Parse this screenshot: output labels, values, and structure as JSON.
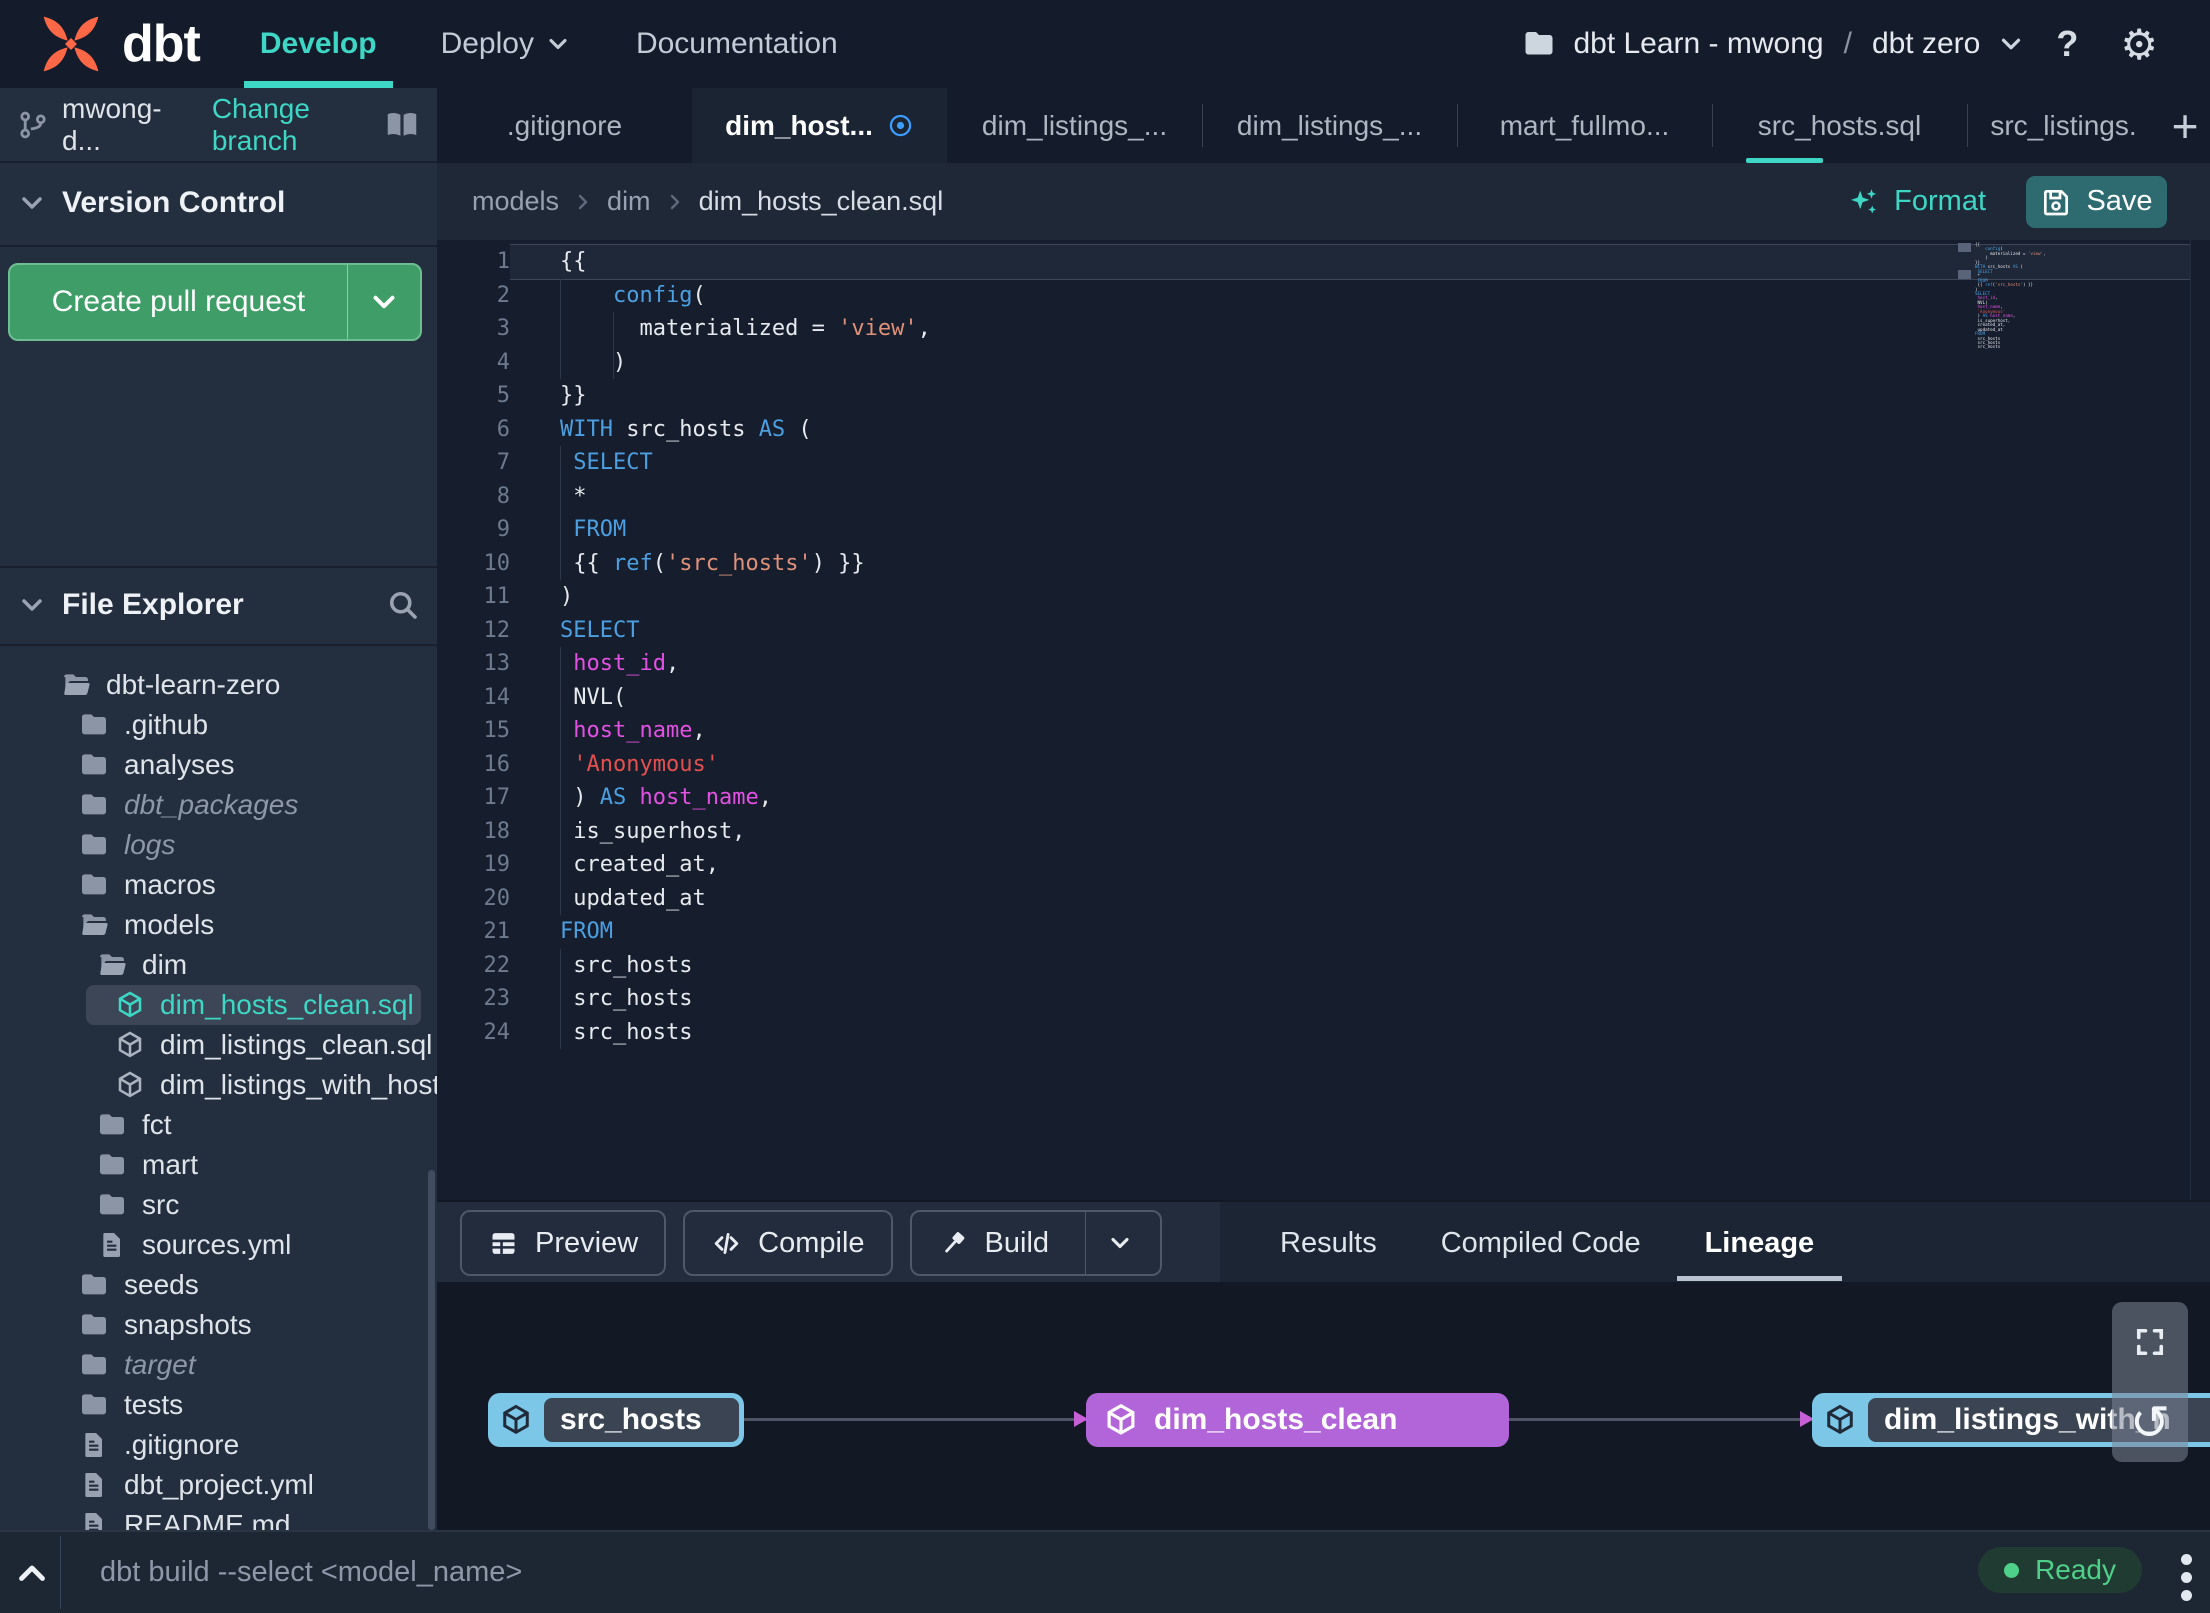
{
  "colors": {
    "accent_teal": "#3ed6c4",
    "pr_green": "#3f9d68",
    "save_teal": "#2d6b71",
    "node_blue": "#7cc7e8",
    "node_purple": "#b264d9",
    "status_green": "#4fd08a",
    "modified_blue": "#3b9eff",
    "logo_orange": "#ff6847"
  },
  "icons": {
    "help_glyph": "?",
    "settings_glyph": "⚙",
    "add_tab_glyph": "+",
    "reset_glyph": "↺"
  },
  "nav": {
    "brand": "dbt",
    "menu": [
      {
        "label": "Develop",
        "active": true,
        "chevron": false
      },
      {
        "label": "Deploy",
        "active": false,
        "chevron": true
      },
      {
        "label": "Documentation",
        "active": false,
        "chevron": false
      }
    ],
    "project": {
      "name": "dbt Learn - mwong",
      "separator": "/",
      "env": "dbt zero"
    }
  },
  "sidebar": {
    "branch": {
      "name": "mwong-d...",
      "change_action": "Change branch"
    },
    "version_control": {
      "title": "Version Control",
      "create_pr_label": "Create pull request"
    },
    "file_explorer": {
      "title": "File Explorer"
    },
    "tree": [
      {
        "label": "dbt-learn-zero",
        "icon": "folder-open-icon",
        "level": 0
      },
      {
        "label": ".github",
        "icon": "folder-icon",
        "level": 1
      },
      {
        "label": "analyses",
        "icon": "folder-icon",
        "level": 1
      },
      {
        "label": "dbt_packages",
        "icon": "folder-icon",
        "level": 1,
        "dim": true
      },
      {
        "label": "logs",
        "icon": "folder-icon",
        "level": 1,
        "dim": true
      },
      {
        "label": "macros",
        "icon": "folder-icon",
        "level": 1
      },
      {
        "label": "models",
        "icon": "folder-open-icon",
        "level": 1
      },
      {
        "label": "dim",
        "icon": "folder-open-icon",
        "level": 2
      },
      {
        "label": "dim_hosts_clean.sql",
        "icon": "model-cube-icon",
        "level": 3,
        "selected": true,
        "modified": true
      },
      {
        "label": "dim_listings_clean.sql",
        "icon": "model-cube-icon",
        "level": 3
      },
      {
        "label": "dim_listings_with_hosts...",
        "icon": "model-cube-icon",
        "level": 3
      },
      {
        "label": "fct",
        "icon": "folder-icon",
        "level": 2
      },
      {
        "label": "mart",
        "icon": "folder-icon",
        "level": 2
      },
      {
        "label": "src",
        "icon": "folder-icon",
        "level": 2
      },
      {
        "label": "sources.yml",
        "icon": "file-icon",
        "level": 2
      },
      {
        "label": "seeds",
        "icon": "folder-icon",
        "level": 1
      },
      {
        "label": "snapshots",
        "icon": "folder-icon",
        "level": 1
      },
      {
        "label": "target",
        "icon": "folder-icon",
        "level": 1,
        "dim": true
      },
      {
        "label": "tests",
        "icon": "folder-icon",
        "level": 1
      },
      {
        "label": ".gitignore",
        "icon": "file-icon",
        "level": 1
      },
      {
        "label": "dbt_project.yml",
        "icon": "file-icon",
        "level": 1
      },
      {
        "label": "README.md",
        "icon": "file-icon",
        "level": 1
      }
    ]
  },
  "workspace": {
    "tabs": [
      {
        "label": ".gitignore",
        "active": false,
        "modified": false
      },
      {
        "label": "dim_host...",
        "active": true,
        "modified": true
      },
      {
        "label": "dim_listings_...",
        "active": false,
        "modified": false
      },
      {
        "label": "dim_listings_...",
        "active": false,
        "modified": false
      },
      {
        "label": "mart_fullmo...",
        "active": false,
        "modified": false
      },
      {
        "label": "src_hosts.sql",
        "active": false,
        "modified": false
      },
      {
        "label": "src_listings.",
        "active": false,
        "modified": false
      }
    ],
    "breadcrumb": [
      "models",
      "dim",
      "dim_hosts_clean.sql"
    ],
    "format_label": "Format",
    "save_label": "Save"
  },
  "editor": {
    "lines": [
      {
        "n": 1,
        "cur": true,
        "seg": [
          [
            "{{",
            "def"
          ]
        ]
      },
      {
        "n": 2,
        "g": [
          0
        ],
        "seg": [
          [
            "    ",
            "def"
          ],
          [
            "config",
            "kw"
          ],
          [
            "(",
            "def"
          ]
        ]
      },
      {
        "n": 3,
        "g": [
          0,
          4
        ],
        "seg": [
          [
            "      materialized = ",
            "def"
          ],
          [
            "'view'",
            "jstr"
          ],
          [
            ",",
            "def"
          ]
        ]
      },
      {
        "n": 4,
        "g": [
          0,
          4
        ],
        "seg": [
          [
            "    )",
            "def"
          ]
        ]
      },
      {
        "n": 5,
        "seg": [
          [
            "}}",
            "def"
          ]
        ]
      },
      {
        "n": 6,
        "seg": [
          [
            "WITH",
            "kw"
          ],
          [
            " src_hosts ",
            "def"
          ],
          [
            "AS",
            "kw"
          ],
          [
            " (",
            "def"
          ]
        ]
      },
      {
        "n": 7,
        "g": [
          0
        ],
        "seg": [
          [
            " ",
            "def"
          ],
          [
            "SELECT",
            "kw"
          ]
        ]
      },
      {
        "n": 8,
        "g": [
          0
        ],
        "seg": [
          [
            " *",
            "def"
          ]
        ]
      },
      {
        "n": 9,
        "g": [
          0
        ],
        "seg": [
          [
            " ",
            "def"
          ],
          [
            "FROM",
            "kw"
          ]
        ]
      },
      {
        "n": 10,
        "g": [
          0
        ],
        "seg": [
          [
            " {{ ",
            "def"
          ],
          [
            "ref",
            "kw"
          ],
          [
            "(",
            "def"
          ],
          [
            "'src_hosts'",
            "jstr"
          ],
          [
            ") }}",
            "def"
          ]
        ]
      },
      {
        "n": 11,
        "seg": [
          [
            ")",
            "def"
          ]
        ]
      },
      {
        "n": 12,
        "seg": [
          [
            "SELECT",
            "kw"
          ]
        ]
      },
      {
        "n": 13,
        "g": [
          0
        ],
        "seg": [
          [
            " ",
            "def"
          ],
          [
            "host_id",
            "id"
          ],
          [
            ",",
            "def"
          ]
        ]
      },
      {
        "n": 14,
        "g": [
          0
        ],
        "seg": [
          [
            " NVL(",
            "def"
          ]
        ]
      },
      {
        "n": 15,
        "g": [
          0
        ],
        "seg": [
          [
            " ",
            "def"
          ],
          [
            "host_name",
            "id"
          ],
          [
            ",",
            "def"
          ]
        ]
      },
      {
        "n": 16,
        "g": [
          0
        ],
        "seg": [
          [
            " ",
            "def"
          ],
          [
            "'Anonymous'",
            "sqlstr"
          ]
        ]
      },
      {
        "n": 17,
        "g": [
          0
        ],
        "seg": [
          [
            " ) ",
            "def"
          ],
          [
            "AS",
            "kw"
          ],
          [
            " ",
            "def"
          ],
          [
            "host_name",
            "id"
          ],
          [
            ",",
            "def"
          ]
        ]
      },
      {
        "n": 18,
        "g": [
          0
        ],
        "seg": [
          [
            " is_superhost,",
            "def"
          ]
        ]
      },
      {
        "n": 19,
        "g": [
          0
        ],
        "seg": [
          [
            " created_at,",
            "def"
          ]
        ]
      },
      {
        "n": 20,
        "g": [
          0
        ],
        "seg": [
          [
            " updated_at",
            "def"
          ]
        ]
      },
      {
        "n": 21,
        "seg": [
          [
            "FROM",
            "kw"
          ]
        ]
      },
      {
        "n": 22,
        "g": [
          0
        ],
        "seg": [
          [
            " src_hosts",
            "def"
          ]
        ]
      },
      {
        "n": 23,
        "g": [
          0
        ],
        "seg": [
          [
            " src_hosts",
            "def"
          ]
        ]
      },
      {
        "n": 24,
        "g": [
          0
        ],
        "seg": [
          [
            " src_hosts",
            "def"
          ]
        ]
      }
    ]
  },
  "bottom_panel": {
    "buttons": [
      {
        "label": "Preview",
        "icon": "table-icon",
        "split": false
      },
      {
        "label": "Compile",
        "icon": "code-icon",
        "split": false
      },
      {
        "label": "Build",
        "icon": "hammer-icon",
        "split": true
      }
    ],
    "tabs": [
      {
        "label": "Results",
        "active": false
      },
      {
        "label": "Compiled Code",
        "active": false
      },
      {
        "label": "Lineage",
        "active": true
      }
    ]
  },
  "lineage": {
    "nodes": [
      {
        "label": "src_hosts",
        "type": "source"
      },
      {
        "label": "dim_hosts_clean",
        "type": "model"
      },
      {
        "label": "dim_listings_with_h",
        "type": "source"
      }
    ]
  },
  "status_bar": {
    "command": "dbt build --select <model_name>",
    "status_label": "Ready"
  }
}
